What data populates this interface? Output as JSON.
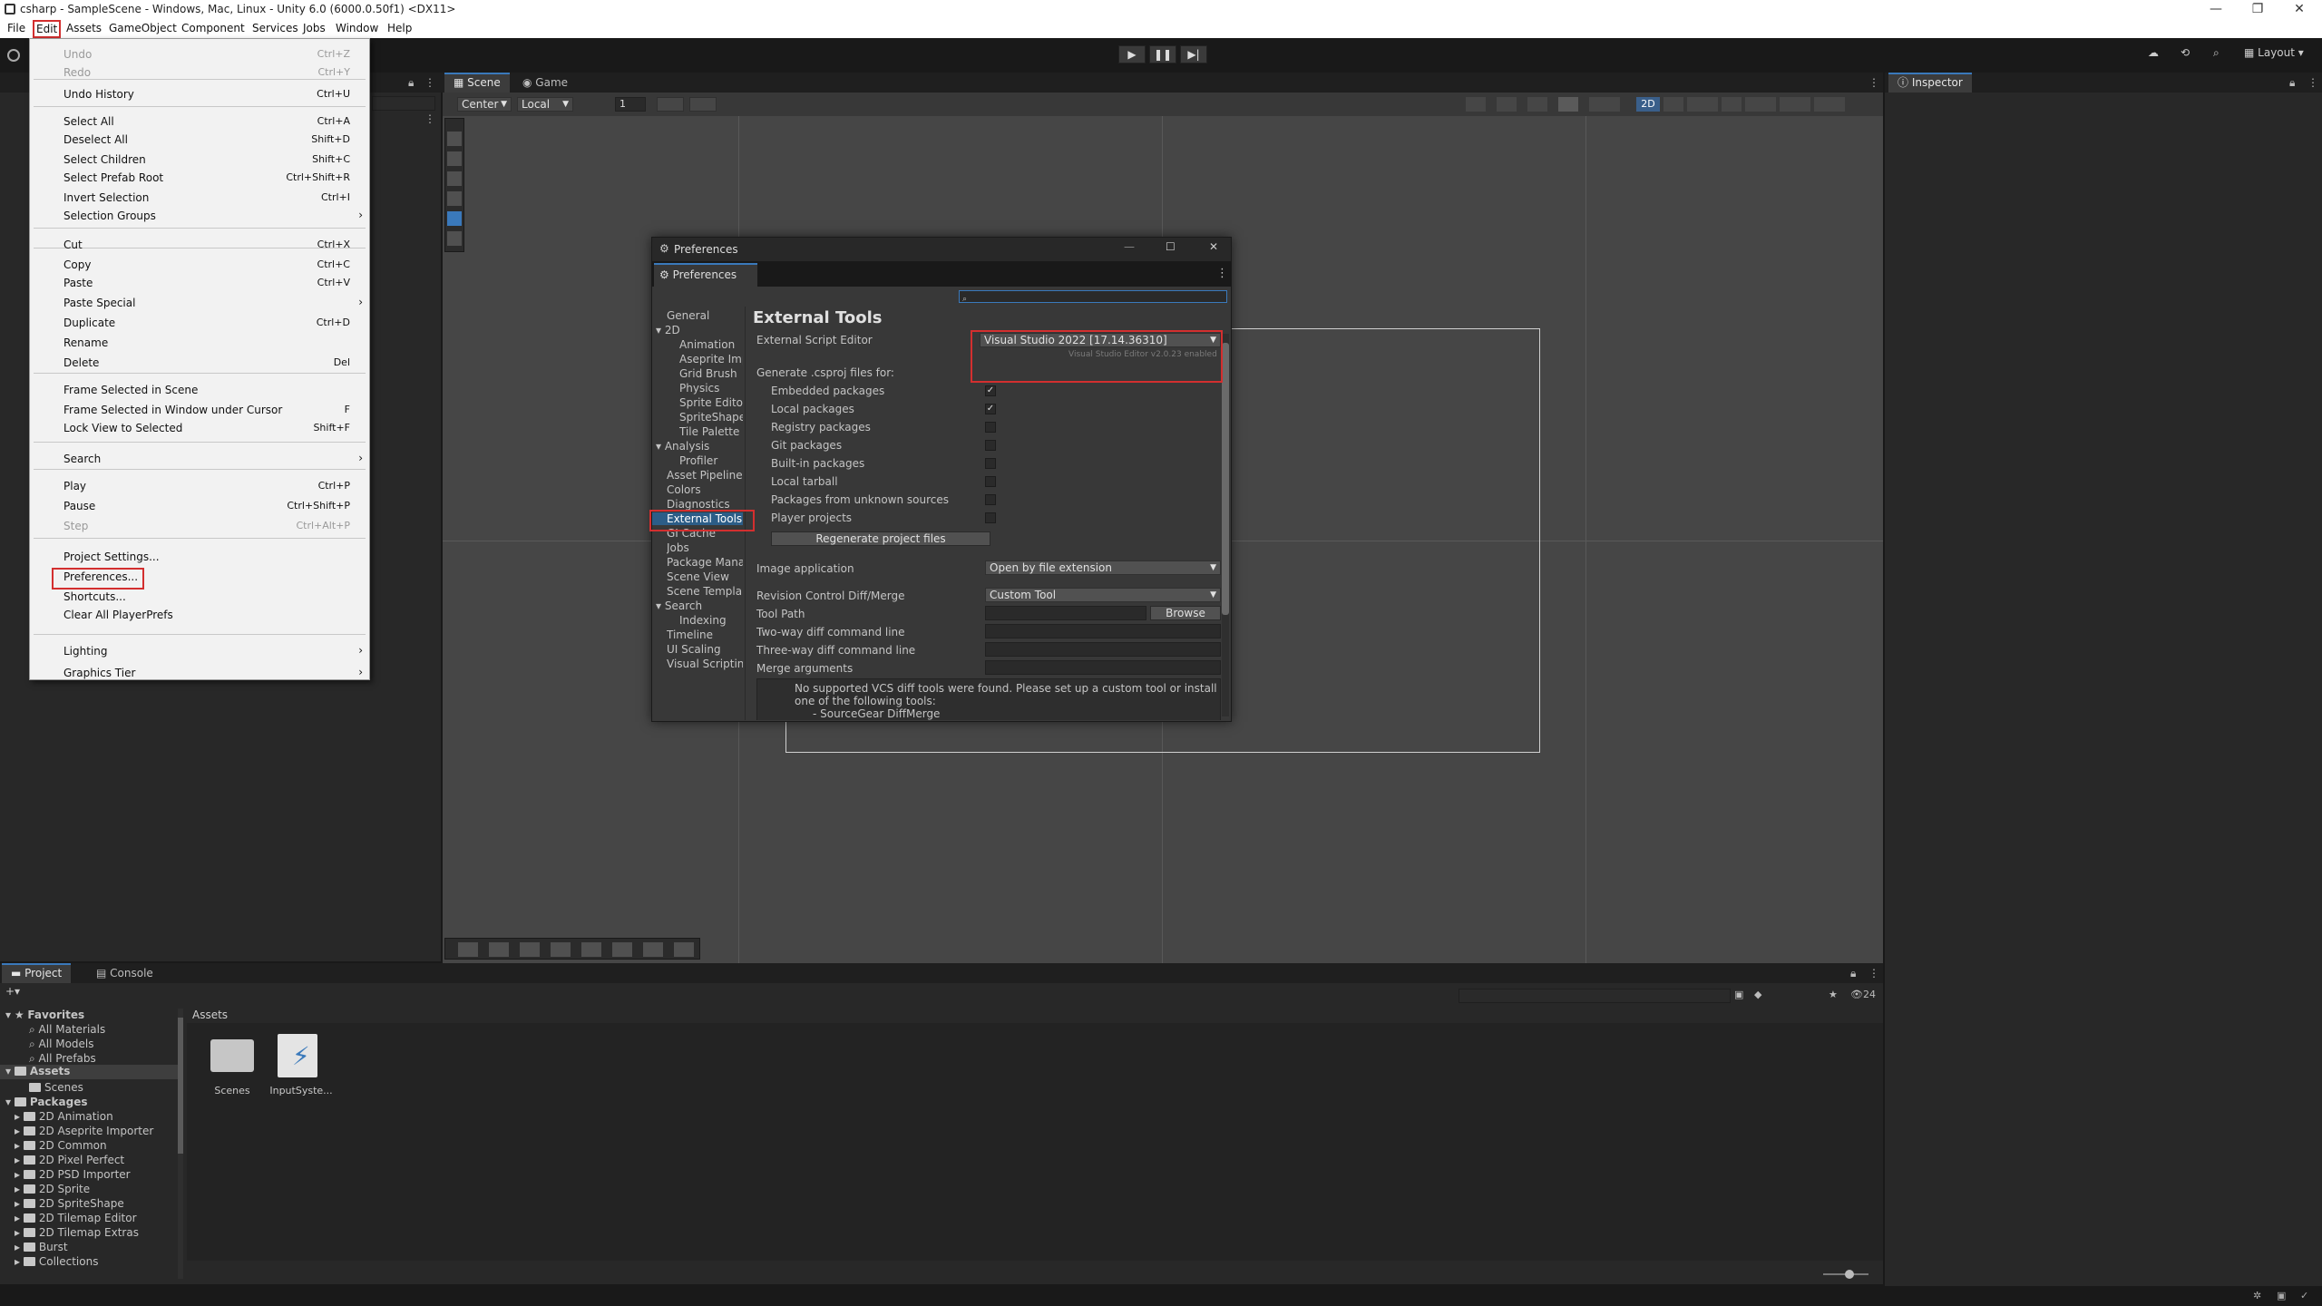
{
  "window": {
    "title": "csharp - SampleScene - Windows, Mac, Linux - Unity 6.0 (6000.0.50f1) <DX11>",
    "controls": [
      "—",
      "❐",
      "✕"
    ]
  },
  "menubar": [
    "File",
    "Edit",
    "Assets",
    "GameObject",
    "Component",
    "Services",
    "Jobs",
    "Window",
    "Help"
  ],
  "toolbar": {
    "layout_label": "Layout"
  },
  "scene_tabs": {
    "scene": "Scene",
    "game": "Game"
  },
  "scene_toolbar": {
    "pivot": "Center",
    "space": "Local",
    "snap_value": "1",
    "mode_2d": "2D"
  },
  "inspector": {
    "tab": "Inspector"
  },
  "edit_menu": {
    "items": [
      {
        "label": "Undo",
        "shortcut": "Ctrl+Z",
        "disabled": true
      },
      {
        "label": "Redo",
        "shortcut": "Ctrl+Y",
        "disabled": true
      },
      {
        "label": "Undo History",
        "shortcut": "Ctrl+U"
      },
      {
        "label": "Select All",
        "shortcut": "Ctrl+A"
      },
      {
        "label": "Deselect All",
        "shortcut": "Shift+D"
      },
      {
        "label": "Select Children",
        "shortcut": "Shift+C"
      },
      {
        "label": "Select Prefab Root",
        "shortcut": "Ctrl+Shift+R"
      },
      {
        "label": "Invert Selection",
        "shortcut": "Ctrl+I"
      },
      {
        "label": "Selection Groups",
        "submenu": true
      },
      {
        "label": "Cut",
        "shortcut": "Ctrl+X"
      },
      {
        "label": "Copy",
        "shortcut": "Ctrl+C"
      },
      {
        "label": "Paste",
        "shortcut": "Ctrl+V"
      },
      {
        "label": "Paste Special",
        "submenu": true
      },
      {
        "label": "Duplicate",
        "shortcut": "Ctrl+D"
      },
      {
        "label": "Rename",
        "shortcut": ""
      },
      {
        "label": "Delete",
        "shortcut": "Del"
      },
      {
        "label": "Frame Selected in Scene",
        "shortcut": ""
      },
      {
        "label": "Frame Selected in Window under Cursor",
        "shortcut": "F"
      },
      {
        "label": "Lock View to Selected",
        "shortcut": "Shift+F"
      },
      {
        "label": "Search",
        "submenu": true
      },
      {
        "label": "Play",
        "shortcut": "Ctrl+P"
      },
      {
        "label": "Pause",
        "shortcut": "Ctrl+Shift+P"
      },
      {
        "label": "Step",
        "shortcut": "Ctrl+Alt+P",
        "disabled": true
      },
      {
        "label": "Project Settings...",
        "shortcut": ""
      },
      {
        "label": "Preferences...",
        "shortcut": ""
      },
      {
        "label": "Shortcuts...",
        "shortcut": ""
      },
      {
        "label": "Clear All PlayerPrefs",
        "shortcut": ""
      },
      {
        "label": "Lighting",
        "submenu": true
      },
      {
        "label": "Graphics Tier",
        "submenu": true
      }
    ]
  },
  "preferences": {
    "window_title": "Preferences",
    "tab": "Preferences",
    "nav": [
      {
        "label": "General",
        "indent": 0
      },
      {
        "label": "2D",
        "indent": 0,
        "expandable": true
      },
      {
        "label": "Animation",
        "indent": 2
      },
      {
        "label": "Aseprite Impo",
        "indent": 2
      },
      {
        "label": "Grid Brush",
        "indent": 2
      },
      {
        "label": "Physics",
        "indent": 2
      },
      {
        "label": "Sprite Editor",
        "indent": 2
      },
      {
        "label": "SpriteShape",
        "indent": 2
      },
      {
        "label": "Tile Palette",
        "indent": 2
      },
      {
        "label": "Analysis",
        "indent": 0,
        "expandable": true
      },
      {
        "label": "Profiler",
        "indent": 2
      },
      {
        "label": "Asset Pipeline",
        "indent": 1
      },
      {
        "label": "Colors",
        "indent": 1
      },
      {
        "label": "Diagnostics",
        "indent": 1
      },
      {
        "label": "External Tools",
        "indent": 1,
        "selected": true
      },
      {
        "label": "GI Cache",
        "indent": 1
      },
      {
        "label": "Jobs",
        "indent": 1
      },
      {
        "label": "Package Mana",
        "indent": 1
      },
      {
        "label": "Scene View",
        "indent": 1
      },
      {
        "label": "Scene Templa",
        "indent": 1
      },
      {
        "label": "Search",
        "indent": 0,
        "expandable": true
      },
      {
        "label": "Indexing",
        "indent": 2
      },
      {
        "label": "Timeline",
        "indent": 1
      },
      {
        "label": "UI Scaling",
        "indent": 1
      },
      {
        "label": "Visual Scriptin",
        "indent": 1
      }
    ],
    "section_title": "External Tools",
    "script_editor_label": "External Script Editor",
    "script_editor_value": "Visual Studio 2022 [17.14.36310]",
    "script_editor_note": "Visual Studio Editor v2.0.23 enabled",
    "csproj_label": "Generate .csproj files for:",
    "csproj_options": [
      {
        "label": "Embedded packages",
        "checked": true
      },
      {
        "label": "Local packages",
        "checked": true
      },
      {
        "label": "Registry packages",
        "checked": false
      },
      {
        "label": "Git packages",
        "checked": false
      },
      {
        "label": "Built-in packages",
        "checked": false
      },
      {
        "label": "Local tarball",
        "checked": false
      },
      {
        "label": "Packages from unknown sources",
        "checked": false
      },
      {
        "label": "Player projects",
        "checked": false
      }
    ],
    "regenerate_button": "Regenerate project files",
    "image_app_label": "Image application",
    "image_app_value": "Open by file extension",
    "diff_label": "Revision Control Diff/Merge",
    "diff_value": "Custom Tool",
    "tool_path_label": "Tool Path",
    "browse_button": "Browse",
    "two_way_label": "Two-way diff command line",
    "three_way_label": "Three-way diff command line",
    "merge_args_label": "Merge arguments",
    "help_line1": "No supported VCS diff tools were found. Please set up a custom tool or install",
    "help_line2": "one of the following tools:",
    "help_line3": "- SourceGear DiffMerge"
  },
  "project_panel": {
    "tabs": [
      "Project",
      "Console"
    ],
    "favorites_label": "Favorites",
    "favorites": [
      "All Materials",
      "All Models",
      "All Prefabs"
    ],
    "assets_label": "Assets",
    "assets_children": [
      "Scenes"
    ],
    "packages_label": "Packages",
    "packages": [
      "2D Animation",
      "2D Aseprite Importer",
      "2D Common",
      "2D Pixel Perfect",
      "2D PSD Importer",
      "2D Sprite",
      "2D SpriteShape",
      "2D Tilemap Editor",
      "2D Tilemap Extras",
      "Burst",
      "Collections"
    ],
    "breadcrumb": "Assets",
    "grid_items": [
      "Scenes",
      "InputSyste..."
    ],
    "hidden_count": "24"
  }
}
